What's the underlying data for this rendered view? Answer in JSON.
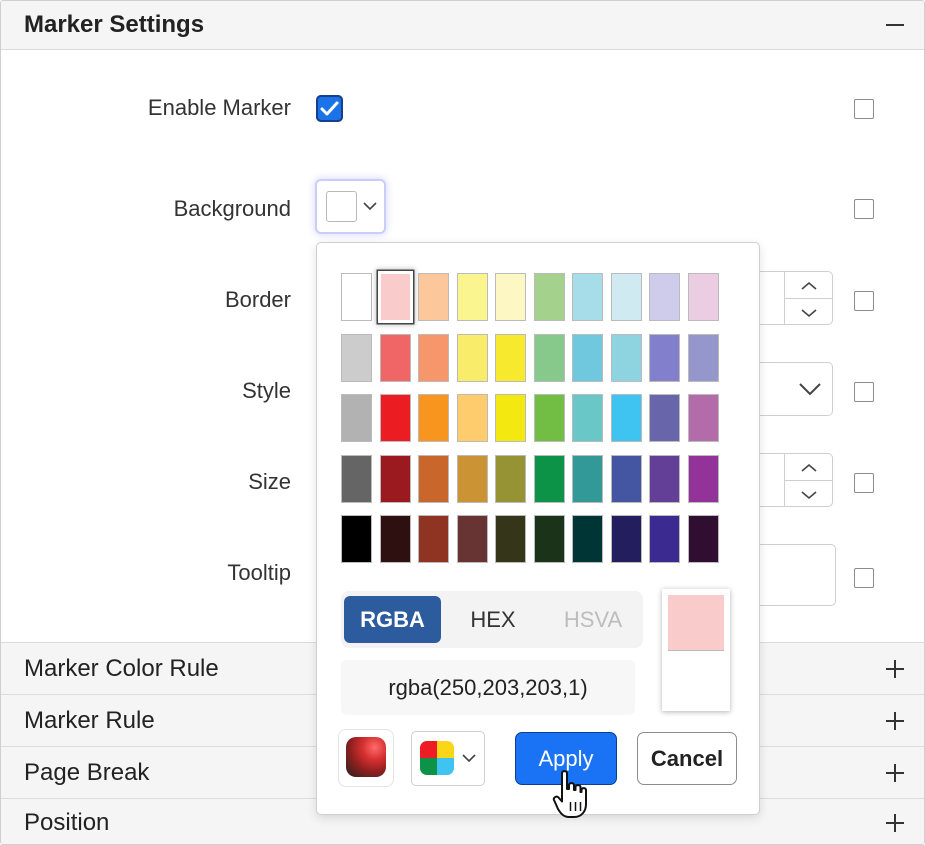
{
  "sections": {
    "main": {
      "title": "Marker Settings"
    },
    "collapsed": [
      {
        "title": "Marker Color Rule"
      },
      {
        "title": "Marker Rule"
      },
      {
        "title": "Page Break"
      },
      {
        "title": "Position"
      }
    ]
  },
  "fields": {
    "enable_marker": {
      "label": "Enable Marker",
      "checked": true
    },
    "background": {
      "label": "Background"
    },
    "border": {
      "label": "Border"
    },
    "style": {
      "label": "Style"
    },
    "size": {
      "label": "Size"
    },
    "tooltip": {
      "label": "Tooltip"
    }
  },
  "picker": {
    "modes": {
      "rgba": "RGBA",
      "hex": "HEX",
      "hsva": "HSVA"
    },
    "active_mode": "RGBA",
    "value": "rgba(250,203,203,1)",
    "preview_color": "#facbcb",
    "apply_label": "Apply",
    "cancel_label": "Cancel",
    "selected_index": 1,
    "palette": [
      [
        "#ffffff",
        "#facbcb",
        "#fcc79a",
        "#fbf58f",
        "#fcf7c3",
        "#a4d28d",
        "#a6dde9",
        "#cfeaf1",
        "#ceccea",
        "#ebcde3"
      ],
      [
        "#cccccc",
        "#f06666",
        "#f8966b",
        "#f9ec6b",
        "#f7e92d",
        "#87c88b",
        "#70c8de",
        "#8ed3e0",
        "#8280cd",
        "#9596cc"
      ],
      [
        "#b2b2b2",
        "#ec1c23",
        "#f8951e",
        "#fecb6d",
        "#f3e911",
        "#72be44",
        "#6ac7c8",
        "#3fc4f2",
        "#6865ab",
        "#b46ba9"
      ],
      [
        "#656565",
        "#9b1a1f",
        "#c8662b",
        "#cb9334",
        "#959333",
        "#0d9348",
        "#339998",
        "#4455a2",
        "#633f98",
        "#93339a"
      ],
      [
        "#000000",
        "#2f1010",
        "#8f3322",
        "#673333",
        "#353619",
        "#1b3419",
        "#003535",
        "#231f5f",
        "#3b2b91",
        "#300e31"
      ]
    ],
    "quick_palette": [
      "#ee1c23",
      "#fbd518",
      "#0d9348",
      "#3fc4f2"
    ]
  }
}
